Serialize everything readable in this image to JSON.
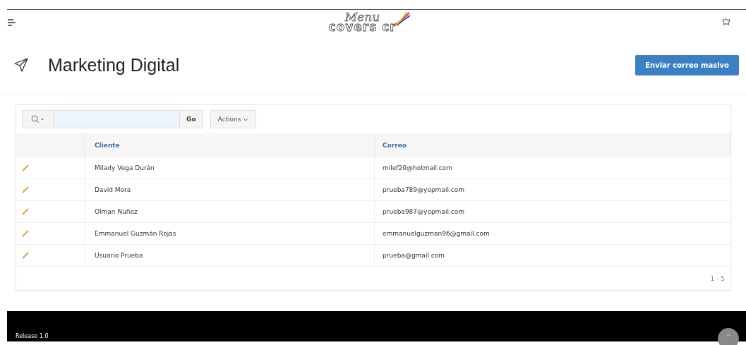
{
  "header": {
    "logo": {
      "line_1": "Menu",
      "line_2": "covers cr"
    }
  },
  "page": {
    "title": "Marketing Digital",
    "button": "Enviar correo masivo"
  },
  "toolbar": {
    "go": "Go",
    "actions": "Actions"
  },
  "table": {
    "columns": [
      "Cliente",
      "Correo"
    ],
    "rows": [
      {
        "cliente": "Milady Vega Durán",
        "correo": "milef20@hotmail.com"
      },
      {
        "cliente": "David Mora",
        "correo": "prueba789@yopmail.com"
      },
      {
        "cliente": "Olman Nuñez",
        "correo": "prueba987@yopmail.com"
      },
      {
        "cliente": "Emmanuel Guzmán Rojas",
        "correo": "emmanuelguzman96@gmail.com"
      },
      {
        "cliente": "Usuario Prueba",
        "correo": "prueba@gmail.com"
      }
    ],
    "pagination": "1 - 5"
  },
  "footer": {
    "release": "Release 1.0"
  }
}
